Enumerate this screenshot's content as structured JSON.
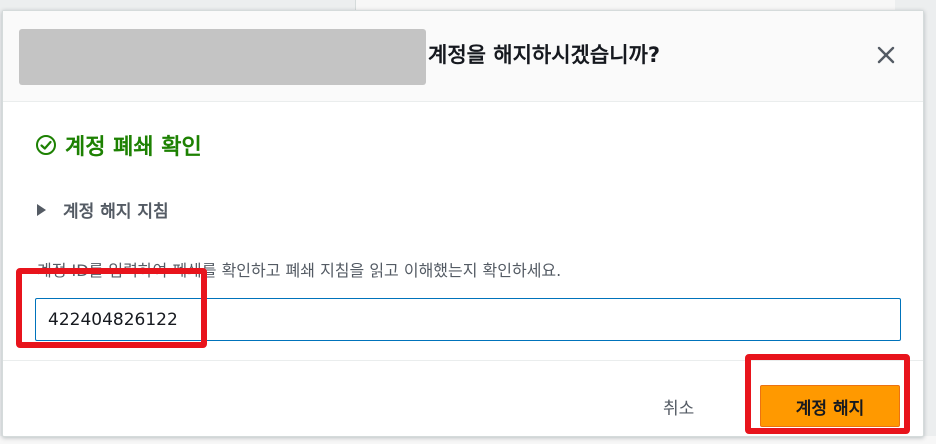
{
  "dialog": {
    "title": "계정을 해지하시겠습니까?",
    "close_icon": "close-icon",
    "confirmation": {
      "icon": "check-circle-icon",
      "title": "계정 폐쇄 확인",
      "color": "#1d8102"
    },
    "expander": {
      "icon": "caret-right-icon",
      "label": "계정 해지 지침"
    },
    "instruction": "계정 ID를 입력하여 폐쇄를 확인하고 폐쇄 지침을 읽고 이해했는지 확인하세요.",
    "account_id_input": {
      "value": "422404826122"
    },
    "footer": {
      "cancel_label": "취소",
      "confirm_label": "계정 해지",
      "confirm_color": "#ff9900"
    },
    "highlight_color": "#e8141c"
  }
}
